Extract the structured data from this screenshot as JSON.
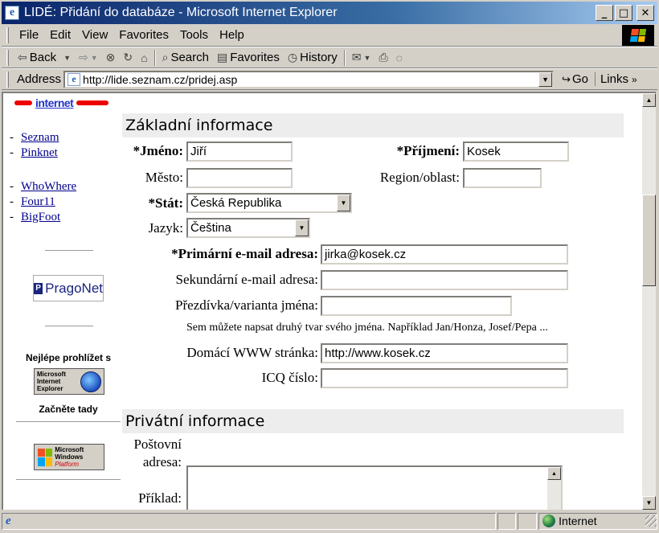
{
  "window": {
    "title": "LIDÉ: Přidání do databáze - Microsoft Internet Explorer",
    "minimize_glyph": "_",
    "maximize_glyph": "□",
    "close_glyph": "✕"
  },
  "menu": [
    "File",
    "Edit",
    "View",
    "Favorites",
    "Tools",
    "Help"
  ],
  "toolbar": {
    "back": "Back",
    "search": "Search",
    "favorites": "Favorites",
    "history": "History"
  },
  "address": {
    "label": "Address",
    "url": "http://lide.seznam.cz/pridej.asp",
    "go": "Go",
    "links": "Links"
  },
  "sidebar": {
    "brand": "internet",
    "links_group1": [
      "Seznam",
      "Pinknet"
    ],
    "links_group2": [
      "WhoWhere",
      "Four11",
      "BigFoot"
    ],
    "pragonet": "PragoNet",
    "best_view": "Nejlépe prohlížet s",
    "ie_badge": "Microsoft Internet Explorer",
    "start_here": "Začněte tady",
    "windows_badge_top": "Microsoft Windows",
    "windows_badge_bottom": "Platform"
  },
  "sections": {
    "basic": "Základní informace",
    "private": "Privátní informace"
  },
  "form": {
    "jmeno_label": "*Jméno:",
    "jmeno_value": "Jiří",
    "prijmeni_label": "*Příjmení:",
    "prijmeni_value": "Kosek",
    "mesto_label": "Město:",
    "mesto_value": "",
    "region_label": "Region/oblast:",
    "region_value": "",
    "stat_label": "*Stát:",
    "stat_value": "Česká Republika",
    "jazyk_label": "Jazyk:",
    "jazyk_value": "Čeština",
    "primary_email_label": "*Primární e-mail adresa:",
    "primary_email_value": "jirka@kosek.cz",
    "secondary_email_label": "Sekundární e-mail adresa:",
    "secondary_email_value": "",
    "nickname_label": "Přezdívka/varianta jména:",
    "nickname_value": "",
    "nickname_hint": "Sem můžete napsat druhý tvar svého jména. Například Jan/Honza, Josef/Pepa ...",
    "homepage_label": "Domácí WWW stránka:",
    "homepage_value": "http://www.kosek.cz",
    "icq_label": "ICQ číslo:",
    "icq_value": "",
    "postal_label_1": "Poštovní",
    "postal_label_2": "adresa:",
    "example_label": "Příklad:"
  },
  "status": {
    "zone": "Internet"
  },
  "colors": {
    "titlebar_start": "#0a246a",
    "titlebar_end": "#a6caf0",
    "link": "#00008b",
    "section_bg": "#ededed"
  }
}
